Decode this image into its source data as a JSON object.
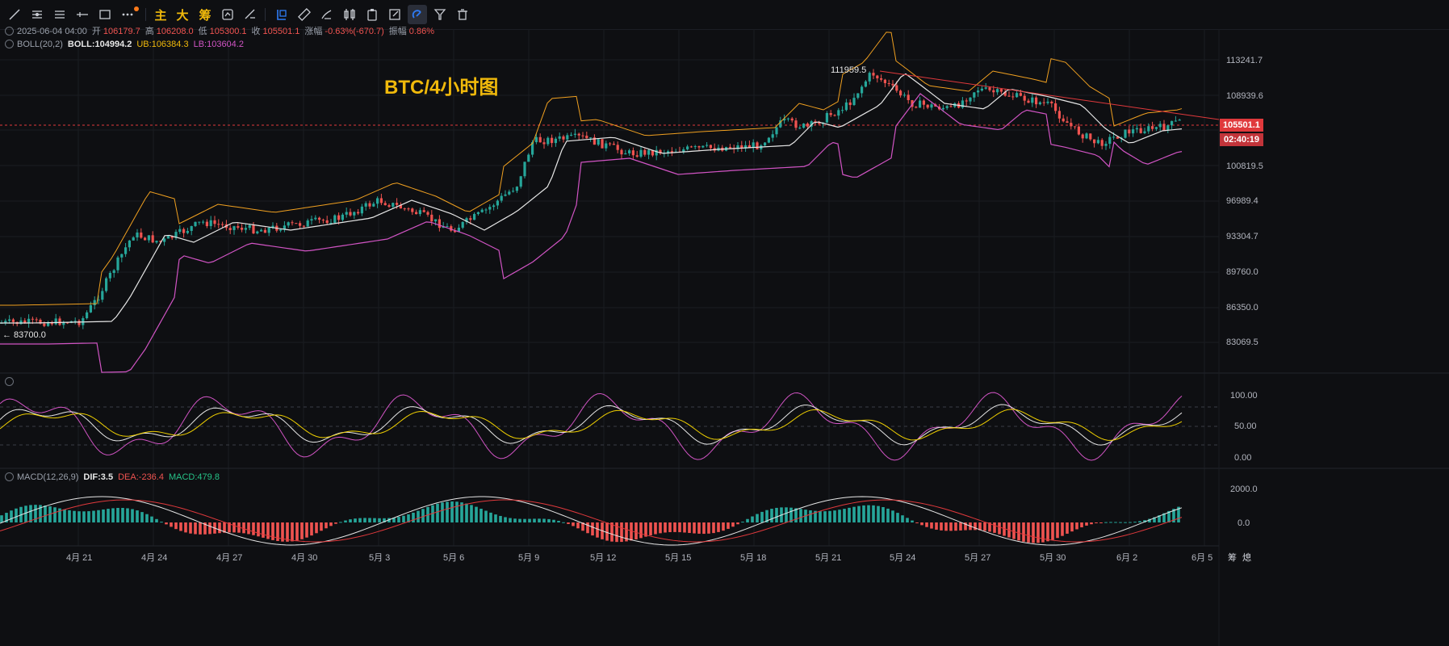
{
  "toolbar": {
    "text_buttons": [
      "主",
      "大",
      "筹"
    ]
  },
  "legend": {
    "datetime": "2025-06-04 04:00",
    "open_label": "开",
    "open": "106179.7",
    "high_label": "高",
    "high": "106208.0",
    "low_label": "低",
    "low": "105300.1",
    "close_label": "收",
    "close": "105501.1",
    "change_label": "涨幅",
    "change": "-0.63%(-670.7)",
    "amplitude_label": "振幅",
    "amplitude": "0.86%",
    "boll_name": "BOLL(20,2)",
    "boll_mid": "BOLL:104994.2",
    "boll_ub": "UB:106384.3",
    "boll_lb": "LB:103604.2",
    "macd_name": "MACD(12,26,9)",
    "macd_dif": "DIF:3.5",
    "macd_dea": "DEA:-236.4",
    "macd_val": "MACD:479.8"
  },
  "chart_title": "BTC/4小时图",
  "annotations": {
    "high_marker": "111959.5",
    "low_marker": "← 83700.0"
  },
  "price_axis": [
    "113241.7",
    "108939.6",
    "100819.5",
    "96989.4",
    "93304.7",
    "89760.0",
    "86350.0",
    "83069.5"
  ],
  "current_price": "105501.1",
  "countdown": "02:40:19",
  "osc_axis": [
    "100.00",
    "50.00",
    "0.00"
  ],
  "macd_axis": [
    "2000.0",
    "0.0"
  ],
  "date_axis": [
    "4月 21",
    "4月 24",
    "4月 27",
    "4月 30",
    "5月 3",
    "5月 6",
    "5月 9",
    "5月 12",
    "5月 15",
    "5月 18",
    "5月 21",
    "5月 24",
    "5月 27",
    "5月 30",
    "6月 2",
    "6月 5"
  ],
  "axis_corner": [
    "筹",
    "熄"
  ],
  "colors": {
    "up": "#26a69a",
    "down": "#ef5350",
    "boll_mid": "#e6e6e6",
    "boll_ub": "#f0a020",
    "boll_lb": "#d154c4",
    "title": "#f0b90b"
  }
}
